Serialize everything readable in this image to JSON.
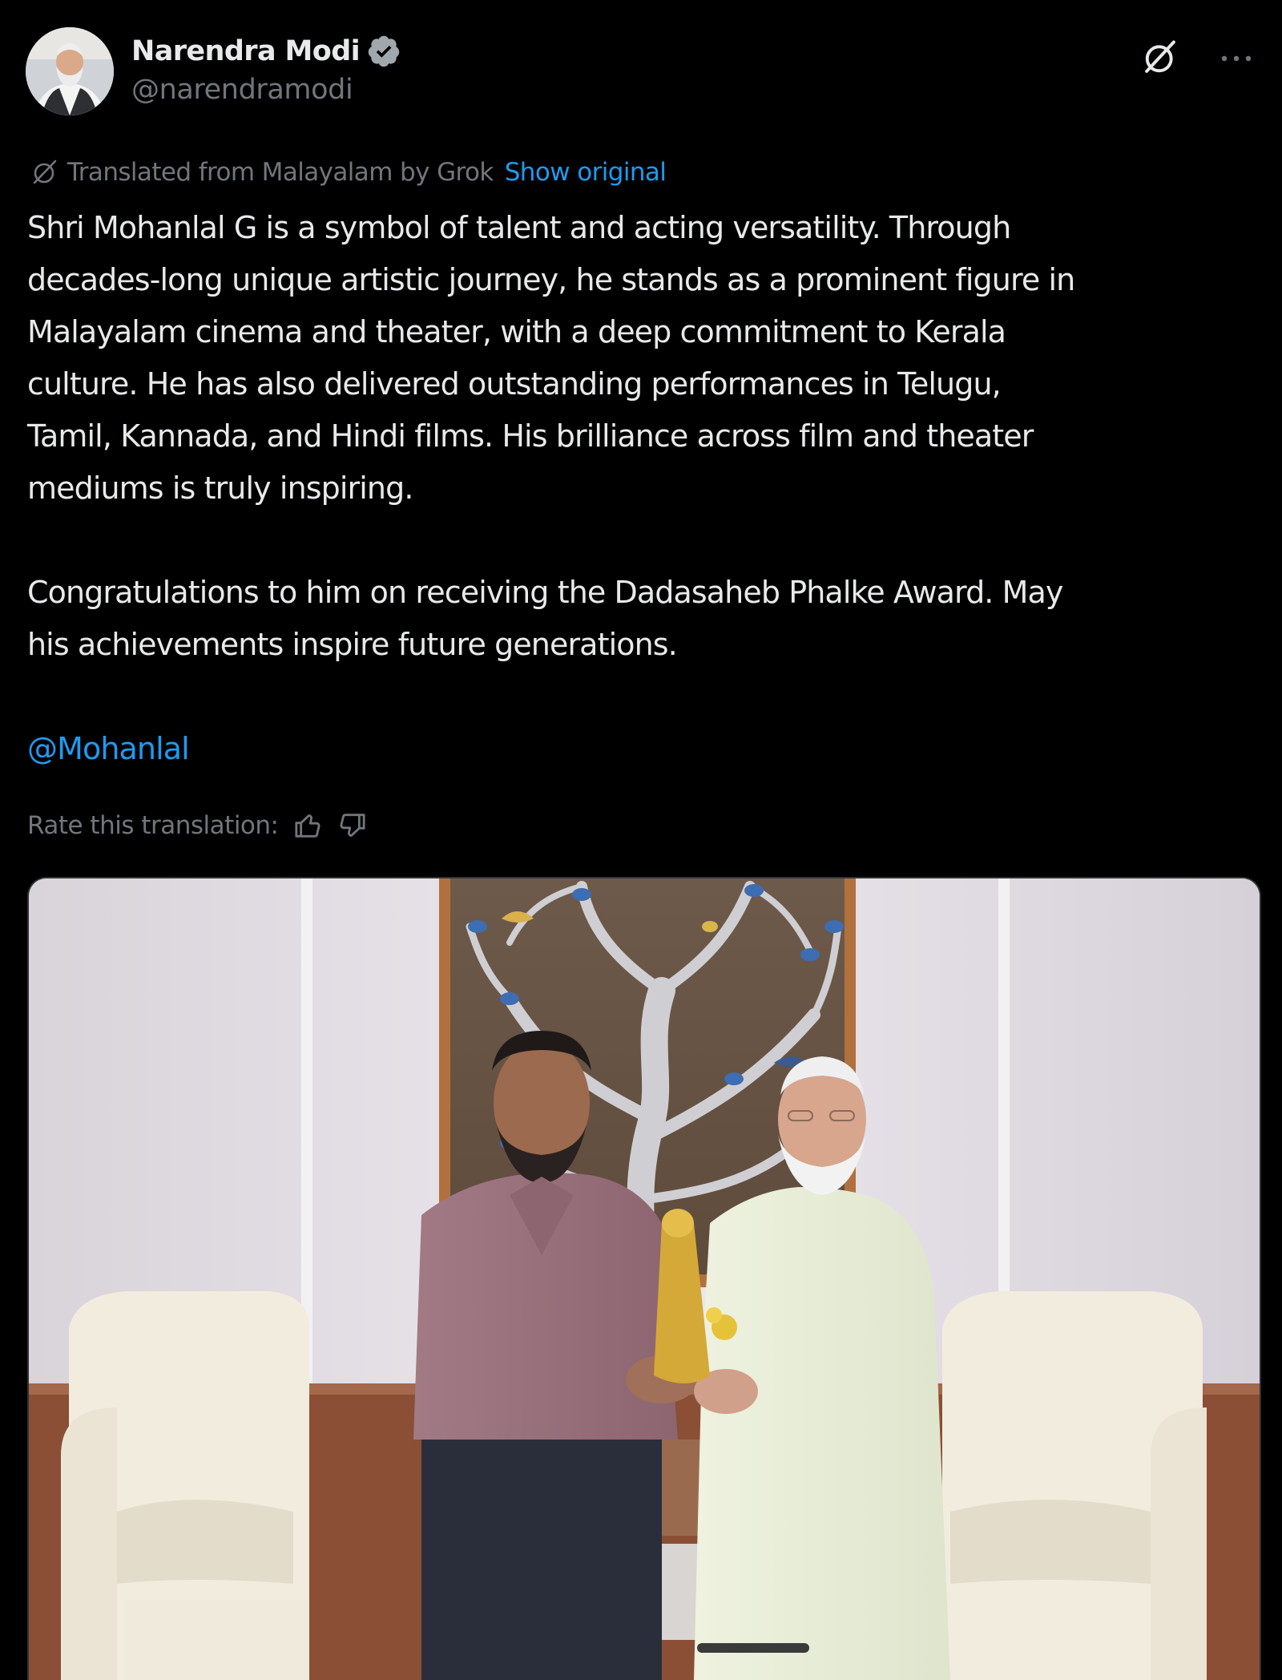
{
  "post": {
    "author": {
      "display_name": "Narendra Modi",
      "handle": "@narendramodi",
      "verified": true,
      "avatar_icon": "profile-photo"
    },
    "actions": {
      "grok_icon": "grok-icon",
      "more_icon": "more-dots-icon"
    },
    "translation": {
      "notice": "Translated from Malayalam by Grok",
      "show_original_label": "Show original",
      "rate_label": "Rate this translation:",
      "thumbs_up_icon": "thumbs-up-icon",
      "thumbs_down_icon": "thumbs-down-icon"
    },
    "text": {
      "paragraph_1": "Shri Mohanlal G is a symbol of talent and acting versatility. Through\ndecades-long unique artistic journey, he stands as a prominent figure in\nMalayalam cinema and theater, with a deep commitment to Kerala\nculture. He has also delivered outstanding performances in Telugu,\nTamil, Kannada, and Hindi films. His brilliance across film and theater\nmediums is truly inspiring.",
      "paragraph_2": "Congratulations to him on receiving the Dadasaheb Phalke Award. May\nhis achievements inspire future generations.",
      "mention": "@Mohanlal"
    },
    "media": {
      "type": "photo"
    }
  },
  "colors": {
    "background": "#000000",
    "text_primary": "#e7e9ea",
    "text_secondary": "#71767b",
    "link": "#1d9bf0",
    "verified_badge": "#a0a7ad"
  }
}
